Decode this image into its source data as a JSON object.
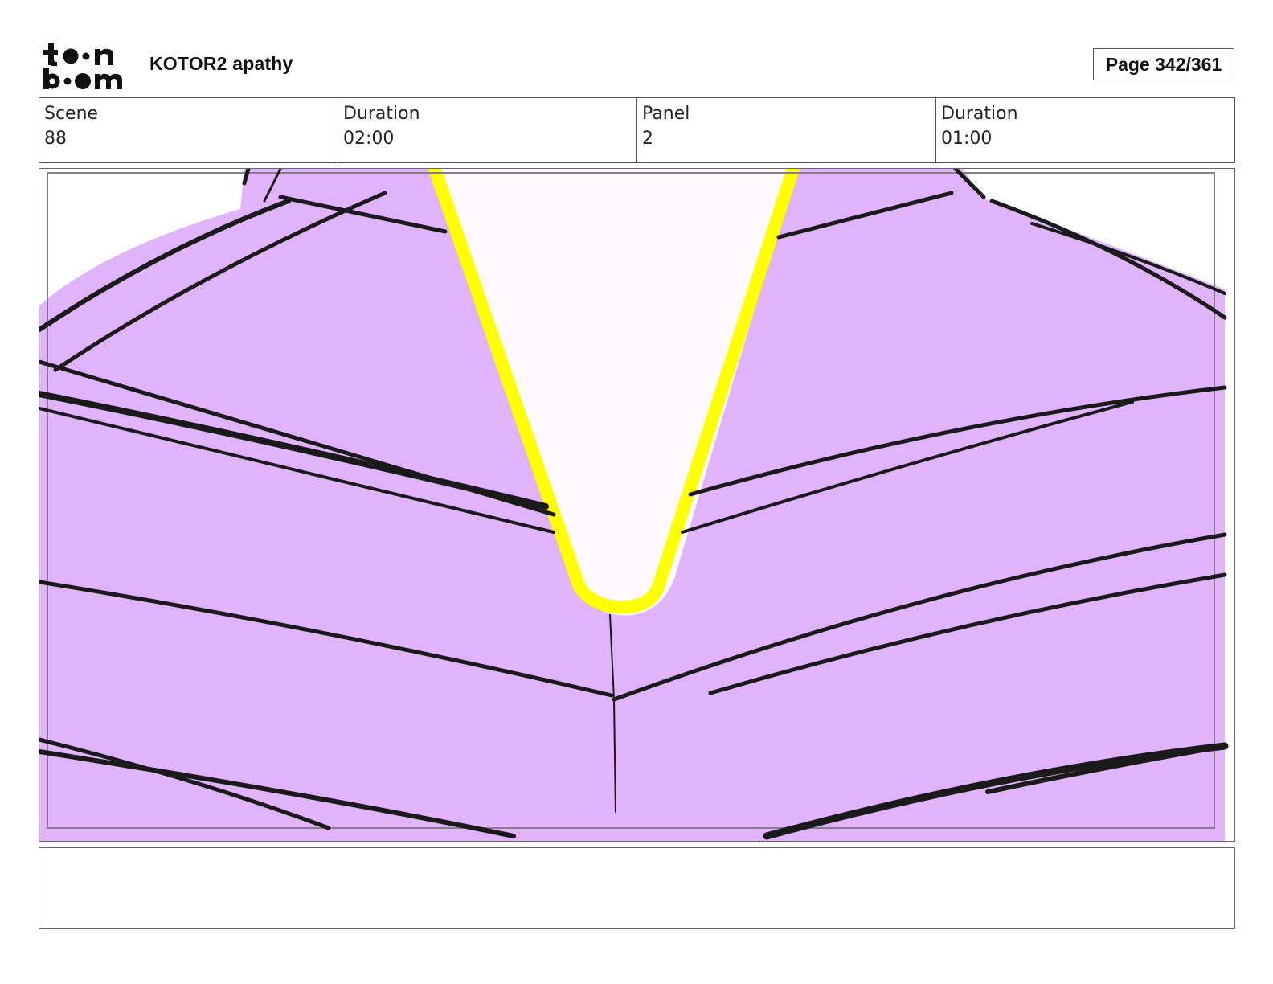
{
  "header": {
    "logo_text": "toon boom",
    "project_title": "KOTOR2 apathy",
    "page_label": "Page 342/361"
  },
  "info": {
    "scene_label": "Scene",
    "scene_value": "88",
    "scene_duration_label": "Duration",
    "scene_duration_value": "02:00",
    "panel_label": "Panel",
    "panel_value": "2",
    "panel_duration_label": "Duration",
    "panel_duration_value": "01:00"
  },
  "panel": {
    "colors": {
      "garment": "#e0b3fb",
      "collar": "#ffff00",
      "skin": "#fdf9fd",
      "ink": "#1a1a1a"
    }
  },
  "notes": {
    "text": ""
  }
}
